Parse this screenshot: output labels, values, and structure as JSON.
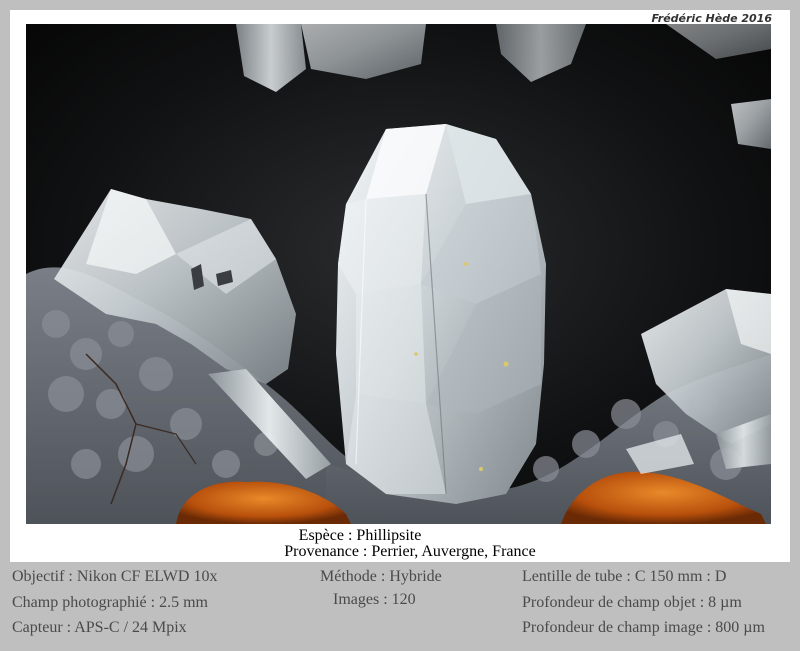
{
  "credit": "Frédéric Hède 2016",
  "caption": {
    "species": "Espèce : Phillipsite",
    "provenance": "Provenance : Perrier, Auvergne, France"
  },
  "info": {
    "objective": "Objectif : Nikon CF ELWD 10x",
    "field": "Champ photographié : 2.5 mm",
    "sensor": "Capteur : APS-C / 24 Mpix",
    "method": "Méthode : Hybride",
    "images": "Images : 120",
    "tube_lens": "Lentille de tube : C 150 mm : D",
    "dof_object": "Profondeur de champ objet : 8 µm",
    "dof_image": "Profondeur de champ image : 800 µm"
  },
  "colors": {
    "frame": "#bfbfbf",
    "mat": "#ffffff",
    "info_text": "#4a4a4a",
    "crystal": "#e8eef0",
    "matrix": "#6d717a",
    "orange_mineral": "#c2570f"
  },
  "photo_subject": "phillipsite crystals on grey matrix with orange mineral, black background"
}
